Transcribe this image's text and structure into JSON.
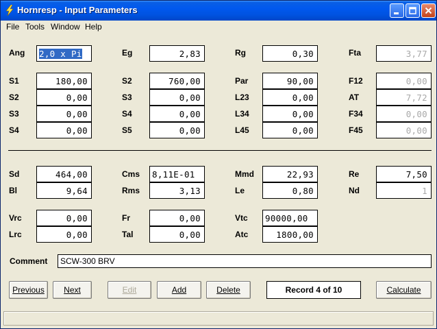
{
  "window": {
    "title": "Hornresp - Input Parameters"
  },
  "menu": {
    "items": [
      "File",
      "Tools",
      "Window",
      "Help"
    ]
  },
  "params": {
    "Ang": {
      "label": "Ang",
      "value": "2,0 x Pi"
    },
    "Eg": {
      "label": "Eg",
      "value": "2,83"
    },
    "Rg": {
      "label": "Rg",
      "value": "0,30"
    },
    "Fta": {
      "label": "Fta",
      "value": "3,77"
    },
    "S1": {
      "label": "S1",
      "value": "180,00"
    },
    "S2a": {
      "label": "S2",
      "value": "0,00"
    },
    "S3a": {
      "label": "S3",
      "value": "0,00"
    },
    "S4a": {
      "label": "S4",
      "value": "0,00"
    },
    "S2b": {
      "label": "S2",
      "value": "760,00"
    },
    "S3b": {
      "label": "S3",
      "value": "0,00"
    },
    "S4b": {
      "label": "S4",
      "value": "0,00"
    },
    "S5": {
      "label": "S5",
      "value": "0,00"
    },
    "Par": {
      "label": "Par",
      "value": "90,00"
    },
    "L23": {
      "label": "L23",
      "value": "0,00"
    },
    "L34": {
      "label": "L34",
      "value": "0,00"
    },
    "L45": {
      "label": "L45",
      "value": "0,00"
    },
    "F12": {
      "label": "F12",
      "value": "0,00"
    },
    "AT": {
      "label": "AT",
      "value": "7,72"
    },
    "F34": {
      "label": "F34",
      "value": "0,00"
    },
    "F45": {
      "label": "F45",
      "value": "0,00"
    },
    "Sd": {
      "label": "Sd",
      "value": "464,00"
    },
    "Bl": {
      "label": "Bl",
      "value": "9,64"
    },
    "Cms": {
      "label": "Cms",
      "value": "8,11E-01"
    },
    "Rms": {
      "label": "Rms",
      "value": "3,13"
    },
    "Mmd": {
      "label": "Mmd",
      "value": "22,93"
    },
    "Le": {
      "label": "Le",
      "value": "0,80"
    },
    "Re": {
      "label": "Re",
      "value": "7,50"
    },
    "Nd": {
      "label": "Nd",
      "value": "1"
    },
    "Vrc": {
      "label": "Vrc",
      "value": "0,00"
    },
    "Lrc": {
      "label": "Lrc",
      "value": "0,00"
    },
    "Fr": {
      "label": "Fr",
      "value": "0,00"
    },
    "Tal": {
      "label": "Tal",
      "value": "0,00"
    },
    "Vtc": {
      "label": "Vtc",
      "value": "90000,00"
    },
    "Atc": {
      "label": "Atc",
      "value": "1800,00"
    }
  },
  "comment": {
    "label": "Comment",
    "value": "SCW-300 BRV"
  },
  "buttons": {
    "previous": "Previous",
    "next": "Next",
    "edit": "Edit",
    "add": "Add",
    "delete": "Delete",
    "calculate": "Calculate"
  },
  "record": "Record 4 of 10",
  "colors": {
    "title_bar": "#0058ee",
    "selection": "#316ac5",
    "disabled_text": "#a8a8a8"
  }
}
